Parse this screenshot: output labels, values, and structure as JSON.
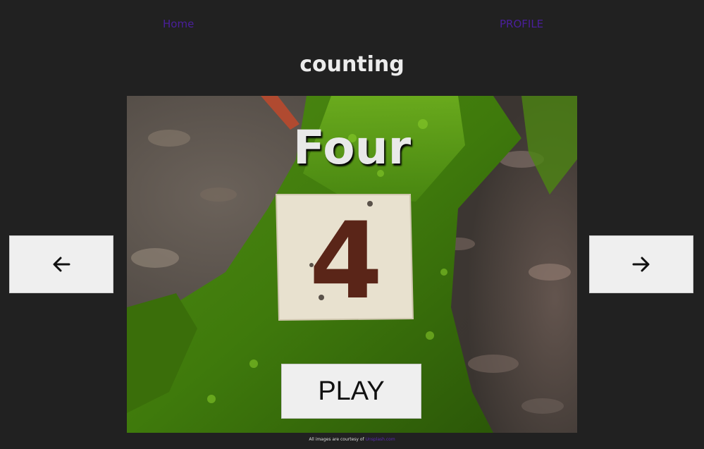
{
  "nav": {
    "home_label": "Home",
    "profile_label": "PROFILE"
  },
  "page_title": "counting",
  "card": {
    "word": "Four",
    "digit": "4",
    "play_label": "PLAY"
  },
  "controls": {
    "prev_icon": "arrow-left-icon",
    "next_icon": "arrow-right-icon"
  },
  "footer": {
    "credit_text": "All images are courtesy of",
    "credit_link": "Unsplash.com"
  },
  "colors": {
    "background": "#212121",
    "link": "#4a1f9c",
    "button": "#efefef"
  }
}
